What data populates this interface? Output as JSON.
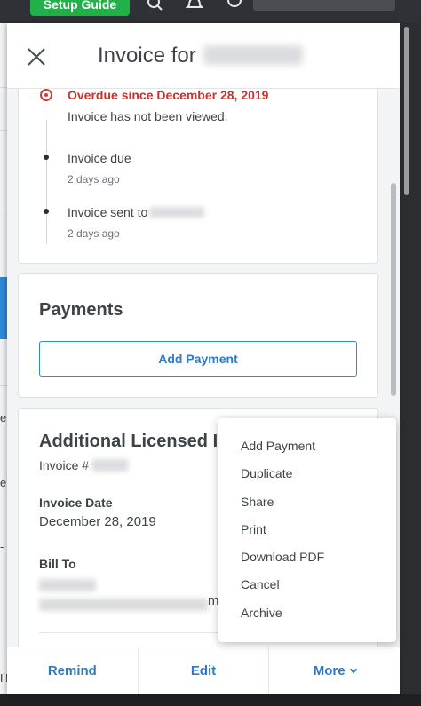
{
  "topbar": {
    "setup_label": "Setup Guide"
  },
  "background": {
    "left_chars": [
      "e",
      "e",
      "-",
      "H"
    ]
  },
  "panel": {
    "title": "Invoice for"
  },
  "timeline": {
    "items": [
      {
        "title": "Overdue since December 28, 2019",
        "subtitle": "Invoice has not been viewed."
      },
      {
        "title": "Invoice due",
        "subtitle": "2 days ago"
      },
      {
        "title": "Invoice sent to",
        "subtitle": "2 days ago"
      }
    ]
  },
  "payments": {
    "heading": "Payments",
    "add_button": "Add Payment"
  },
  "details": {
    "title": "Additional Licensed In",
    "invoice_number_label": "Invoice #",
    "invoice_date_label": "Invoice Date",
    "invoice_date_value": "December 28, 2019",
    "bill_to_label": "Bill To",
    "bill_to_trailing": "m"
  },
  "menu": {
    "items": [
      "Add Payment",
      "Duplicate",
      "Share",
      "Print",
      "Download PDF",
      "Cancel",
      "Archive"
    ]
  },
  "actions": {
    "remind": "Remind",
    "edit": "Edit",
    "more": "More"
  },
  "colors": {
    "overdue": "#c8312c",
    "accent": "#2e7bc4",
    "setup": "#22b04b"
  },
  "icons": [
    "search-icon",
    "bell-icon",
    "help-icon",
    "close-icon",
    "chevron-down-icon"
  ]
}
